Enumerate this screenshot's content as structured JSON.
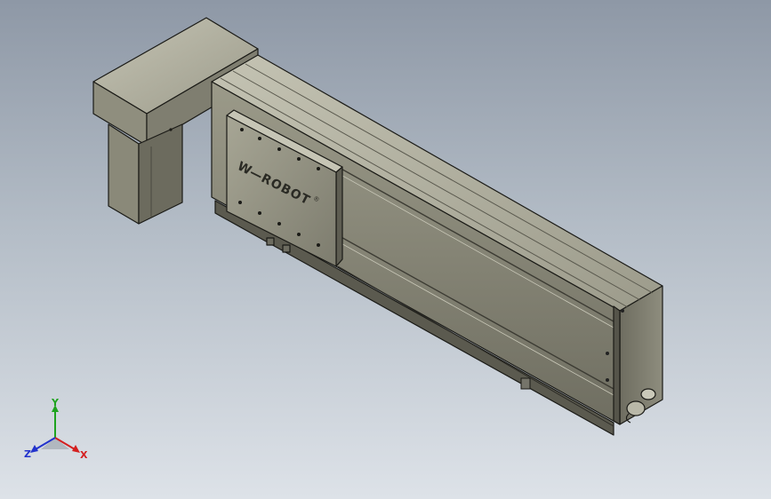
{
  "model": {
    "logo_text": "ROBOT",
    "logo_mark": "W—",
    "registered_mark": "®"
  },
  "triad": {
    "x_label": "X",
    "y_label": "Y",
    "z_label": "Z",
    "colors": {
      "x": "#d42020",
      "y": "#1ea31e",
      "z": "#2233cc"
    }
  },
  "colors": {
    "background_top": "#8e98a6",
    "background_bottom": "#dde2e8",
    "part_body": "#8b8a7a",
    "part_dark": "#5c5b50",
    "part_light": "#b4b3a4",
    "edge": "#1a1a16"
  }
}
